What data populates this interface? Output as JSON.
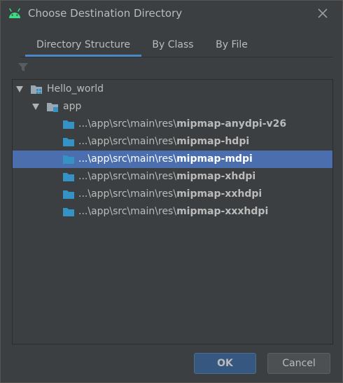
{
  "window": {
    "title": "Choose Destination Directory",
    "title_icon": "android-icon",
    "close_icon": "close-icon"
  },
  "tabs": [
    {
      "label": "Directory Structure",
      "active": true
    },
    {
      "label": "By Class",
      "active": false
    },
    {
      "label": "By File",
      "active": false
    }
  ],
  "filter_icon": "filter-icon",
  "tree": {
    "root": {
      "label": "Hello_world",
      "icon": "project-folder-icon",
      "expanded": true
    },
    "module": {
      "label": "app",
      "icon": "module-folder-icon",
      "expanded": true
    },
    "items": [
      {
        "prefix": "...\\app\\src\\main\\res\\",
        "name": "mipmap-anydpi-v26",
        "selected": false
      },
      {
        "prefix": "...\\app\\src\\main\\res\\",
        "name": "mipmap-hdpi",
        "selected": false
      },
      {
        "prefix": "...\\app\\src\\main\\res\\",
        "name": "mipmap-mdpi",
        "selected": true
      },
      {
        "prefix": "...\\app\\src\\main\\res\\",
        "name": "mipmap-xhdpi",
        "selected": false
      },
      {
        "prefix": "...\\app\\src\\main\\res\\",
        "name": "mipmap-xxhdpi",
        "selected": false
      },
      {
        "prefix": "...\\app\\src\\main\\res\\",
        "name": "mipmap-xxxhdpi",
        "selected": false
      }
    ]
  },
  "buttons": {
    "ok": "OK",
    "cancel": "Cancel"
  },
  "colors": {
    "background": "#3c3f41",
    "selection": "#4b6eaf",
    "accent": "#4a88c7",
    "android_green": "#3ddc84",
    "folder_blue": "#3592c4"
  }
}
